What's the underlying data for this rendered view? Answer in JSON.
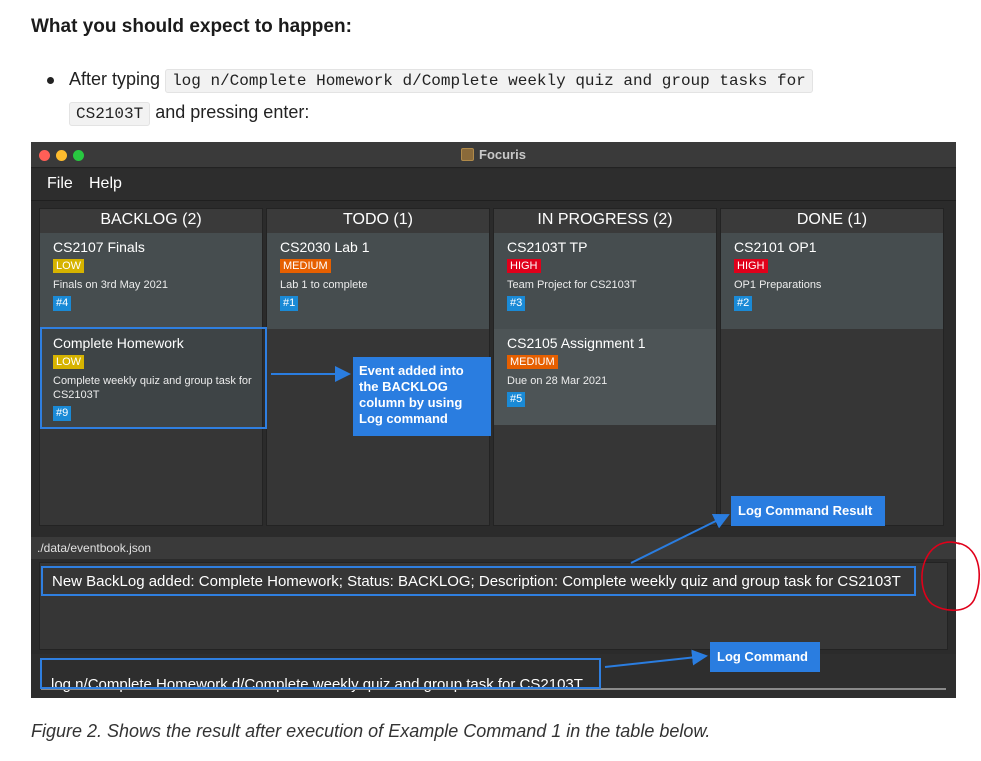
{
  "doc": {
    "heading": "What you should expect to happen:",
    "bullet_prefix": "After typing",
    "bullet_code_line1": "log n/Complete Homework d/Complete weekly quiz and group tasks for",
    "bullet_code_line2": "CS2103T",
    "bullet_suffix": "and pressing enter:",
    "caption": "Figure 2. Shows the result after execution of Example Command 1 in the table below."
  },
  "app": {
    "title": "Focuris",
    "menu": [
      "File",
      "Help"
    ],
    "columns": [
      {
        "header": "BACKLOG (2)",
        "cards": [
          {
            "title": "CS2107 Finals",
            "priority": "LOW",
            "level": "low",
            "desc": "Finals on 3rd May 2021",
            "id": "#4"
          },
          {
            "title": "Complete Homework",
            "priority": "LOW",
            "level": "low",
            "desc": "Complete weekly quiz and group task for CS2103T",
            "id": "#9"
          }
        ]
      },
      {
        "header": "TODO (1)",
        "cards": [
          {
            "title": "CS2030 Lab 1",
            "priority": "MEDIUM",
            "level": "medium",
            "desc": "Lab 1 to complete",
            "id": "#1"
          }
        ]
      },
      {
        "header": "IN PROGRESS (2)",
        "cards": [
          {
            "title": "CS2103T TP",
            "priority": "HIGH",
            "level": "high",
            "desc": "Team Project for CS2103T",
            "id": "#3"
          },
          {
            "title": "CS2105 Assignment 1",
            "priority": "MEDIUM",
            "level": "medium",
            "desc": "Due on 28 Mar 2021",
            "id": "#5"
          }
        ]
      },
      {
        "header": "DONE (1)",
        "cards": [
          {
            "title": "CS2101 OP1",
            "priority": "HIGH",
            "level": "high",
            "desc": "OP1 Preparations",
            "id": "#2"
          }
        ]
      }
    ],
    "file_path": "./data/eventbook.json",
    "result_text": "New BackLog added: Complete Homework; Status: BACKLOG; Description: Complete weekly quiz and group task for CS2103T",
    "command_text": "log n/Complete Homework d/Complete weekly quiz and group task for CS2103T"
  },
  "annotations": {
    "event_added": "Event added into the BACKLOG column by using Log command",
    "log_command_result": "Log Command Result",
    "log_command": "Log Command"
  },
  "colors": {
    "callout_blue": "#2a7de0",
    "low": "#d6b300",
    "medium": "#e65f00",
    "high": "#e0001a",
    "id_badge": "#1a8ad6",
    "annotation_circle": "#e0001a"
  }
}
